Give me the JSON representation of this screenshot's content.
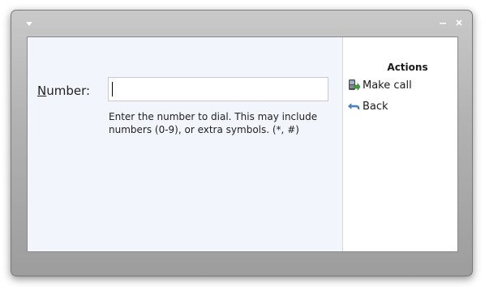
{
  "window": {
    "menu_icon": "dropdown-arrow-icon",
    "controls": {
      "minimize_icon": "minimize-icon",
      "close_icon": "close-icon"
    }
  },
  "form": {
    "number_label_accel": "N",
    "number_label_rest": "umber:",
    "number_value": "",
    "hint": "Enter the number to dial. This may include numbers (0-9), or extra symbols. (*, #)"
  },
  "actions": {
    "title": "Actions",
    "items": [
      {
        "label": "Make call",
        "icon": "phone-call-icon"
      },
      {
        "label": "Back",
        "icon": "back-arrow-icon"
      }
    ]
  }
}
